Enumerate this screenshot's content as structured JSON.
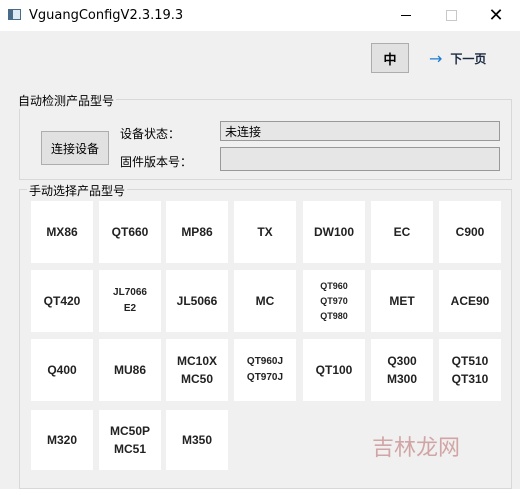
{
  "window": {
    "title": "VguangConfigV2.3.19.3",
    "close_glyph": "✕"
  },
  "toolbar": {
    "lang_label": "中",
    "next_label": "下一页",
    "next_arrow": "→"
  },
  "auto_detect": {
    "group_title": "自动检测产品型号",
    "connect_label": "连接设备",
    "status_label": "设备状态：",
    "status_value": "未连接",
    "firmware_label": "固件版本号：",
    "firmware_value": ""
  },
  "manual_select": {
    "group_title": "手动选择产品型号",
    "tiles": [
      {
        "lines": [
          "MX86"
        ]
      },
      {
        "lines": [
          "QT660"
        ]
      },
      {
        "lines": [
          "MP86"
        ]
      },
      {
        "lines": [
          "TX"
        ]
      },
      {
        "lines": [
          "DW100"
        ]
      },
      {
        "lines": [
          "EC"
        ]
      },
      {
        "lines": [
          "C900"
        ]
      },
      {
        "lines": [
          "QT420"
        ]
      },
      {
        "lines": [
          "JL7066",
          "E2"
        ]
      },
      {
        "lines": [
          "JL5066"
        ]
      },
      {
        "lines": [
          "MC"
        ]
      },
      {
        "lines": [
          "QT960",
          "QT970",
          "QT980"
        ]
      },
      {
        "lines": [
          "MET"
        ]
      },
      {
        "lines": [
          "ACE90"
        ]
      },
      {
        "lines": [
          "Q400"
        ]
      },
      {
        "lines": [
          "MU86"
        ]
      },
      {
        "lines": [
          "MC10X",
          "MC50"
        ]
      },
      {
        "lines": [
          "QT960J",
          "QT970J"
        ]
      },
      {
        "lines": [
          "QT100"
        ]
      },
      {
        "lines": [
          "Q300",
          "M300"
        ]
      },
      {
        "lines": [
          "QT510",
          "QT310"
        ]
      },
      {
        "lines": [
          "M320"
        ]
      },
      {
        "lines": [
          "MC50P",
          "MC51"
        ]
      },
      {
        "lines": [
          "M350"
        ]
      }
    ]
  },
  "watermark": "吉林龙网"
}
